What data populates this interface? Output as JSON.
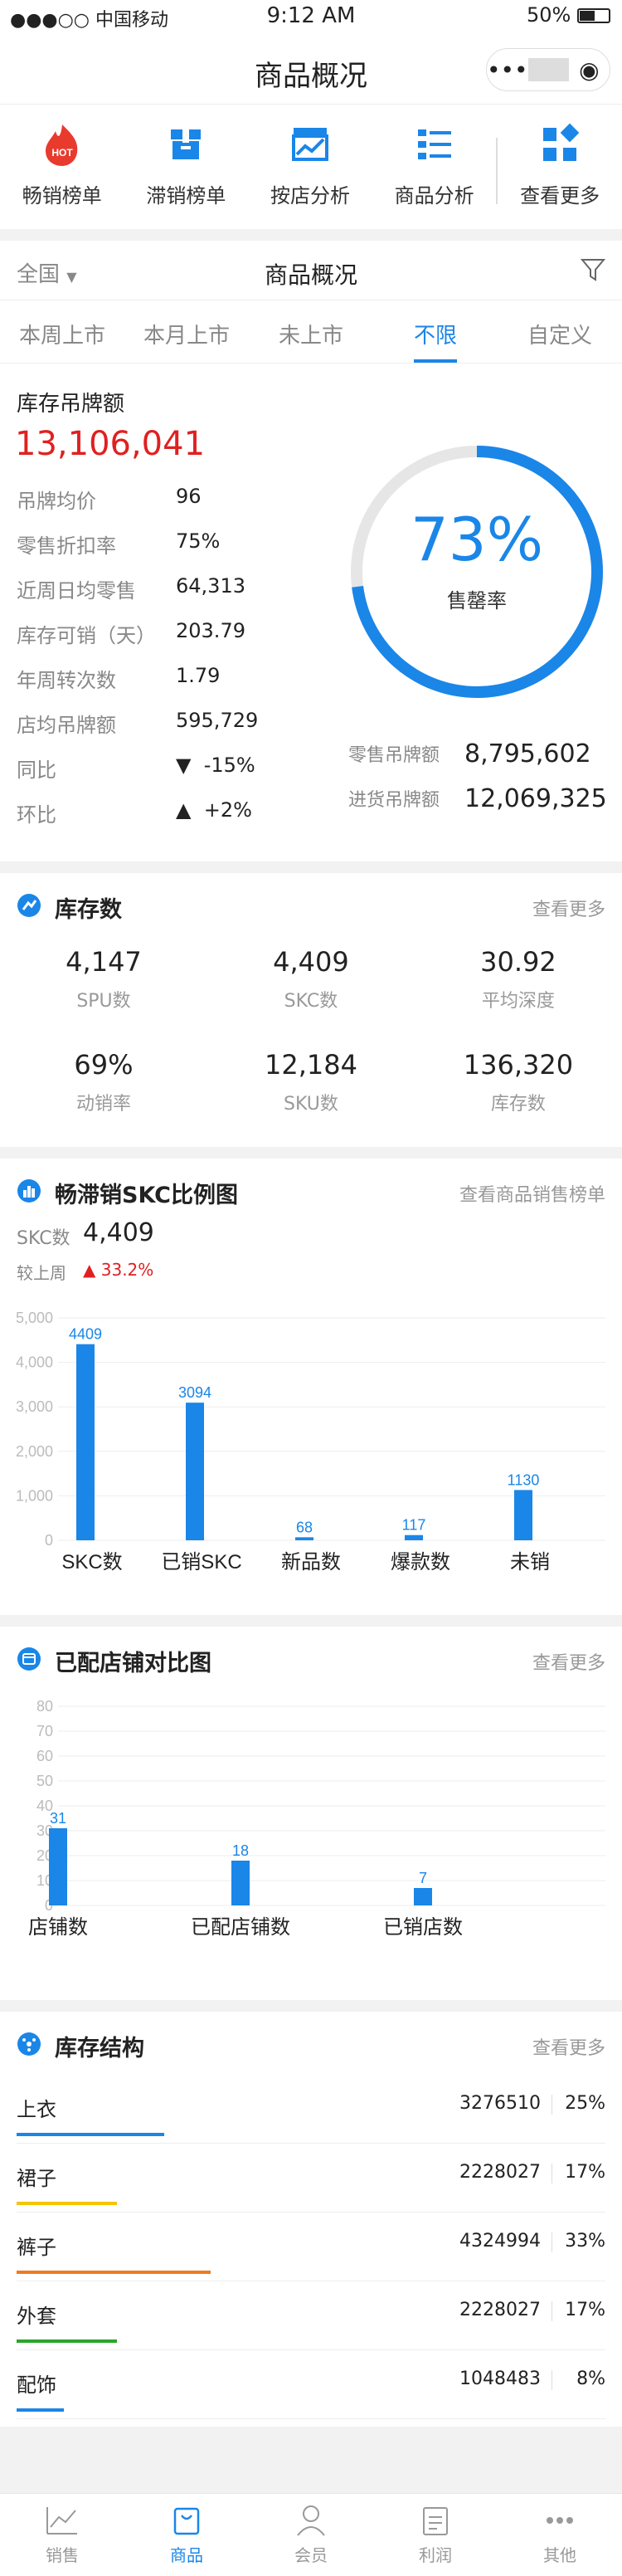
{
  "status": {
    "signal": "●●●○○ 中国移动",
    "time": "9:12 AM",
    "battery": "50%"
  },
  "nav": {
    "title": "商品概况",
    "more": "•••",
    "target": "◉"
  },
  "quick": [
    {
      "label": "畅销榜单",
      "icon": "hot-flame-icon"
    },
    {
      "label": "滞销榜单",
      "icon": "box-icon"
    },
    {
      "label": "按店分析",
      "icon": "store-chart-icon"
    },
    {
      "label": "商品分析",
      "icon": "list-icon"
    },
    {
      "label": "查看更多",
      "icon": "grid-more-icon"
    }
  ],
  "hot_badge": "HOT",
  "filter": {
    "region": "全国",
    "title": "商品概况"
  },
  "tabs": [
    "本周上市",
    "本月上市",
    "未上市",
    "不限",
    "自定义"
  ],
  "tab_active": 3,
  "inventory": {
    "heading": "库存吊牌额",
    "total": "13,106,041",
    "rows": [
      {
        "k": "吊牌均价",
        "v": "96"
      },
      {
        "k": "零售折扣率",
        "v": "75%"
      },
      {
        "k": "近周日均零售",
        "v": "64,313"
      },
      {
        "k": "库存可销（天）",
        "v": "203.79"
      },
      {
        "k": "年周转次数",
        "v": "1.79"
      },
      {
        "k": "店均吊牌额",
        "v": "595,729"
      }
    ],
    "yoy_label": "同比",
    "yoy": "-15%",
    "mom_label": "环比",
    "mom": "+2%",
    "sellthrough": "73%",
    "sellthrough_value": 0.73,
    "sellthrough_label": "售罄率",
    "retail_label": "零售吊牌额",
    "retail": "8,795,602",
    "purchase_label": "进货吊牌额",
    "purchase": "12,069,325"
  },
  "stock": {
    "title": "库存数",
    "more": "查看更多",
    "items": [
      {
        "v": "4,147",
        "l": "SPU数"
      },
      {
        "v": "4,409",
        "l": "SKC数"
      },
      {
        "v": "30.92",
        "l": "平均深度"
      },
      {
        "v": "69%",
        "l": "动销率"
      },
      {
        "v": "12,184",
        "l": "SKU数"
      },
      {
        "v": "136,320",
        "l": "库存数"
      }
    ]
  },
  "skc": {
    "title": "畅滞销SKC比例图",
    "more": "查看商品销售榜单",
    "count_label": "SKC数",
    "count": "4,409",
    "cmp_label": "较上周",
    "cmp": "33.2%"
  },
  "store": {
    "title": "已配店铺对比图",
    "more": "查看更多"
  },
  "structure": {
    "title": "库存结构",
    "more": "查看更多",
    "rows": [
      {
        "name": "上衣",
        "val": "3276510",
        "pct": "25%",
        "color": "#1a86e8",
        "frac": 0.25
      },
      {
        "name": "裙子",
        "val": "2228027",
        "pct": "17%",
        "color": "#f5c400",
        "frac": 0.17
      },
      {
        "name": "裤子",
        "val": "4324994",
        "pct": "33%",
        "color": "#f07a1e",
        "frac": 0.33
      },
      {
        "name": "外套",
        "val": "2228027",
        "pct": "17%",
        "color": "#2aa52a",
        "frac": 0.17
      },
      {
        "name": "配饰",
        "val": "1048483",
        "pct": "8%",
        "color": "#1a86e8",
        "frac": 0.08
      }
    ]
  },
  "tabbar": [
    {
      "label": "销售",
      "icon": "chart-line-icon"
    },
    {
      "label": "商品",
      "icon": "bag-icon"
    },
    {
      "label": "会员",
      "icon": "person-icon"
    },
    {
      "label": "利润",
      "icon": "clipboard-icon"
    },
    {
      "label": "其他",
      "icon": "dots-icon"
    }
  ],
  "tabbar_active": 1,
  "chart_data": [
    {
      "type": "bar",
      "categories": [
        "SKC数",
        "已销SKC",
        "新品数",
        "爆款数",
        "未销"
      ],
      "values": [
        4409,
        3094,
        68,
        117,
        1130
      ],
      "ylim": [
        0,
        5000
      ],
      "yticks": [
        "0",
        "1,000",
        "2,000",
        "3,000",
        "4,000",
        "5,000"
      ],
      "color": "#1a86e8",
      "grid": true
    },
    {
      "type": "bar",
      "categories": [
        "店铺数",
        "已配店铺数",
        "已销店数"
      ],
      "values": [
        31,
        18,
        7
      ],
      "ylim": [
        0,
        80
      ],
      "yticks": [
        "0",
        "10",
        "20",
        "30",
        "40",
        "50",
        "60",
        "70",
        "80"
      ],
      "color": "#1a86e8",
      "grid": true
    }
  ]
}
